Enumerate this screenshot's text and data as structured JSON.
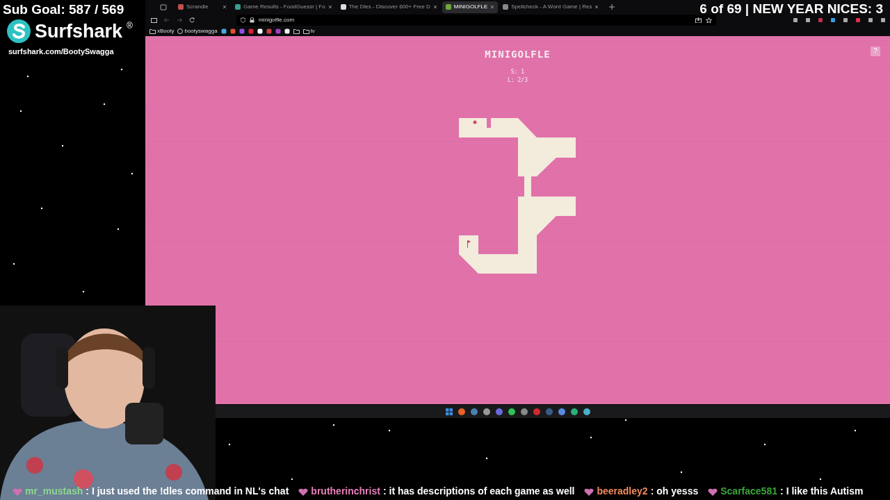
{
  "overlay": {
    "sub_goal": "Sub Goal: 587 / 569",
    "sponsor": "Surfshark",
    "sponsor_mark": "®",
    "sponsor_url": "surfshark.com/BootySwagga",
    "counter": "6 of 69 | NEW YEAR NICES: 3"
  },
  "browser": {
    "tabs": [
      {
        "label": "Scrandle",
        "selected": false
      },
      {
        "label": "Game Results - FoodGuessr | Fo",
        "selected": false
      },
      {
        "label": "The Dles - Discover 600+ Free D",
        "selected": false
      },
      {
        "label": "MINIGOLFLE",
        "selected": true
      },
      {
        "label": "Spellcheck - A Word Game | Res",
        "selected": false
      }
    ],
    "url": "minigolfle.com",
    "bookmarks": [
      {
        "kind": "folder",
        "label": "xBooty"
      },
      {
        "kind": "site",
        "label": "bootyswagga"
      },
      {
        "kind": "icon"
      },
      {
        "kind": "icon"
      },
      {
        "kind": "icon"
      },
      {
        "kind": "icon"
      },
      {
        "kind": "icon"
      },
      {
        "kind": "icon"
      },
      {
        "kind": "icon"
      },
      {
        "kind": "icon"
      },
      {
        "kind": "folder"
      },
      {
        "kind": "folder",
        "label": "tv"
      }
    ]
  },
  "game": {
    "title": "MINIGOLFLE",
    "score": "S: 1",
    "level": "L: 2/3",
    "help": "?"
  },
  "chat": [
    {
      "user": "mr_mustash",
      "color": "#8fd88f",
      "separator": ":",
      "text": "I just used the !dles command in NL's chat"
    },
    {
      "user": "brutherinchrist",
      "color": "#e87fb8",
      "separator": ":",
      "text": "it has descriptions of each game as well"
    },
    {
      "user": "beeradley2",
      "color": "#f08a5d",
      "separator": ":",
      "text": "oh yesss"
    },
    {
      "user": "Scarface581",
      "color": "#3aa63a",
      "separator": ":",
      "text": "I like this Autism"
    }
  ]
}
